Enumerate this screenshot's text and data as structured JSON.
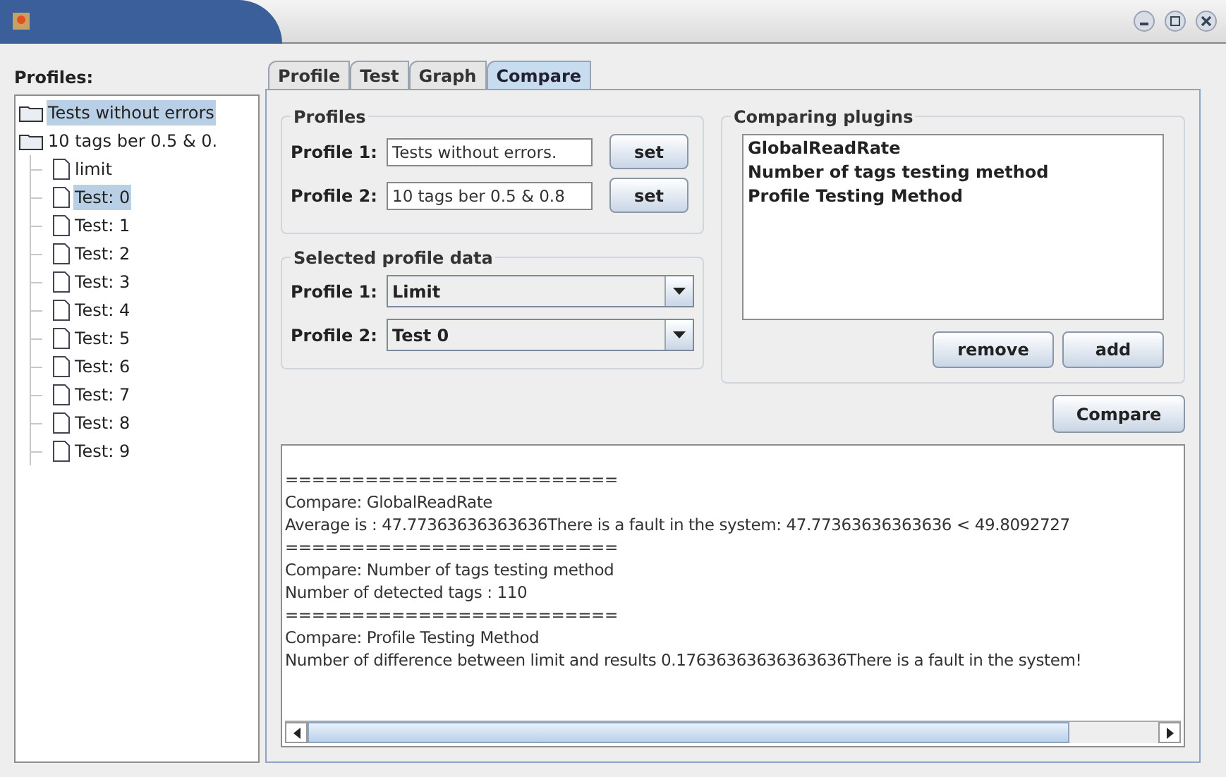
{
  "sidebar": {
    "title": "Profiles:",
    "tree": [
      {
        "label": "Tests without errors",
        "selected": true,
        "kind": "folder"
      },
      {
        "label": "10 tags ber 0.5 & 0.",
        "selected": false,
        "kind": "folder",
        "children": [
          {
            "label": "limit",
            "selected": false,
            "kind": "file"
          },
          {
            "label": "Test: 0",
            "selected": true,
            "kind": "file"
          },
          {
            "label": "Test: 1",
            "selected": false,
            "kind": "file"
          },
          {
            "label": "Test: 2",
            "selected": false,
            "kind": "file"
          },
          {
            "label": "Test: 3",
            "selected": false,
            "kind": "file"
          },
          {
            "label": "Test: 4",
            "selected": false,
            "kind": "file"
          },
          {
            "label": "Test: 5",
            "selected": false,
            "kind": "file"
          },
          {
            "label": "Test: 6",
            "selected": false,
            "kind": "file"
          },
          {
            "label": "Test: 7",
            "selected": false,
            "kind": "file"
          },
          {
            "label": "Test: 8",
            "selected": false,
            "kind": "file"
          },
          {
            "label": "Test: 9",
            "selected": false,
            "kind": "file"
          }
        ]
      }
    ]
  },
  "tabs": [
    {
      "label": "Profile",
      "selected": false
    },
    {
      "label": "Test",
      "selected": false
    },
    {
      "label": "Graph",
      "selected": false
    },
    {
      "label": "Compare",
      "selected": true
    }
  ],
  "profiles": {
    "title": "Profiles",
    "rows": [
      {
        "label": "Profile 1:",
        "value": "Tests without errors.",
        "button": "set"
      },
      {
        "label": "Profile 2:",
        "value": "10 tags ber 0.5 & 0.8",
        "button": "set"
      }
    ]
  },
  "selected_profile_data": {
    "title": "Selected profile data",
    "rows": [
      {
        "label": "Profile 1:",
        "value": "Limit"
      },
      {
        "label": "Profile 2:",
        "value": "Test 0"
      }
    ]
  },
  "comparing_plugins": {
    "title": "Comparing plugins",
    "items": [
      "GlobalReadRate",
      "Number of tags testing method",
      "Profile Testing Method"
    ],
    "buttons": [
      "remove",
      "add"
    ]
  },
  "compare_button": "Compare",
  "output": {
    "lines": [
      "=========================",
      "Compare: GlobalReadRate",
      "Average is : 47.77363636363636There is a fault in the system:  47.77363636363636 < 49.8092727",
      "=========================",
      "Compare: Number of tags testing method",
      "Number of detected tags : 110",
      "=========================",
      "Compare: Profile Testing Method",
      "Number of difference between limit and results 0.17636363636363636There is a fault in the system!"
    ]
  }
}
